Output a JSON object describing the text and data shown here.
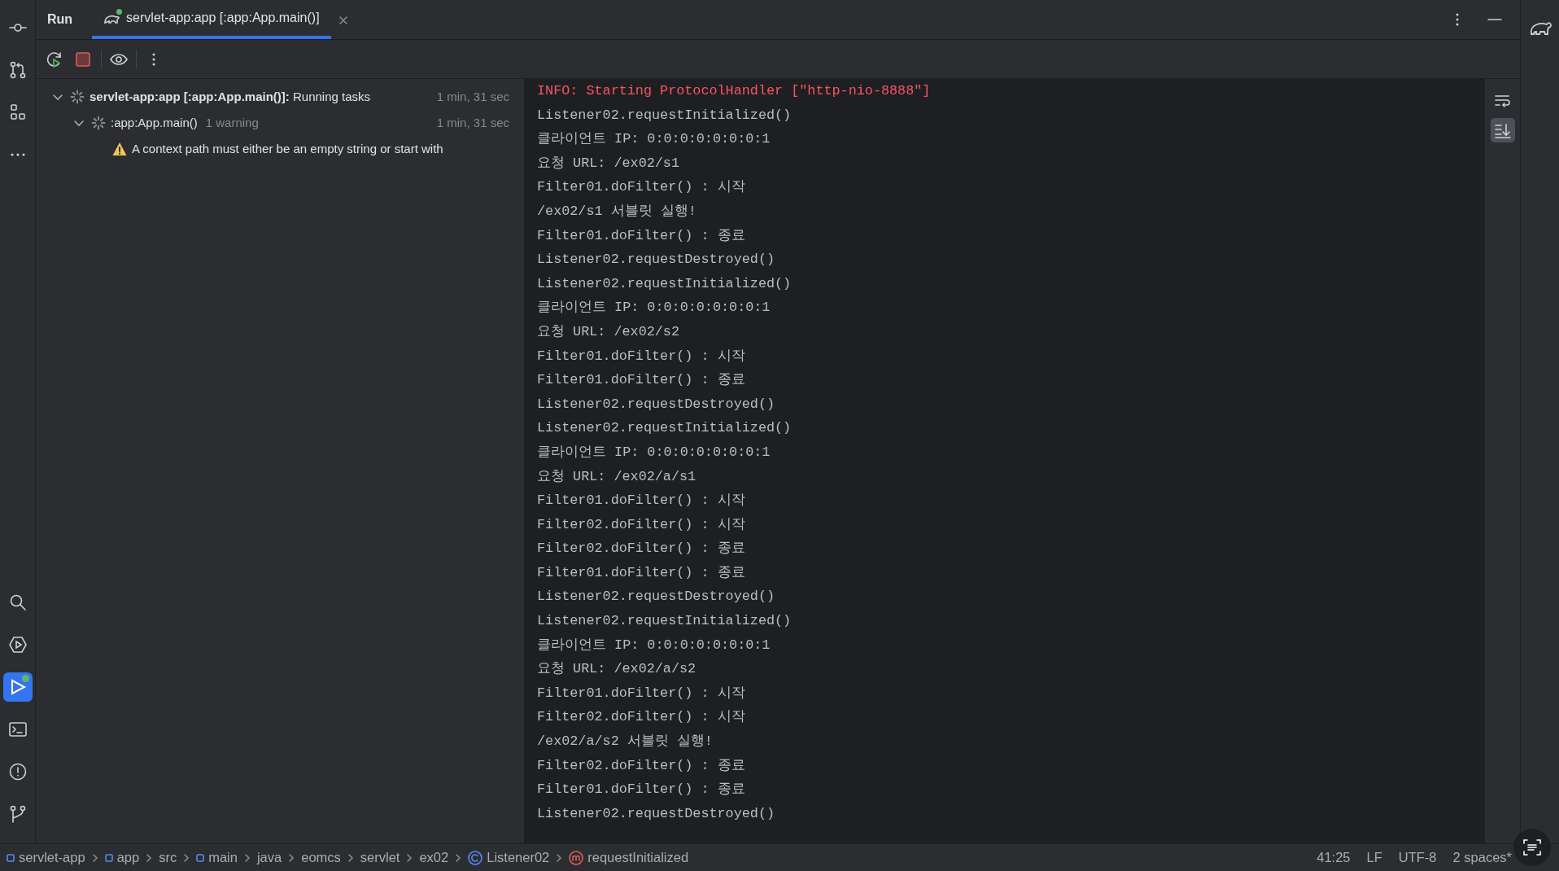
{
  "left_toolbar_top": [
    {
      "kind": "commit",
      "selected": false
    },
    {
      "kind": "pull-requests",
      "selected": false
    },
    {
      "kind": "structure",
      "selected": false
    },
    {
      "kind": "more",
      "selected": false
    }
  ],
  "left_toolbar_bottom": [
    {
      "kind": "search",
      "selected": false
    },
    {
      "kind": "services",
      "selected": false
    },
    {
      "kind": "run",
      "selected": true,
      "running": true
    },
    {
      "kind": "terminal",
      "selected": false
    },
    {
      "kind": "problems",
      "selected": false
    },
    {
      "kind": "git",
      "selected": false
    }
  ],
  "tool_window": {
    "title": "Run",
    "tabs": [
      {
        "label": "servlet-app:app [:app:App.main()]",
        "selected": true,
        "running": true
      }
    ]
  },
  "toolbar": [
    {
      "kind": "rerun"
    },
    {
      "kind": "stop"
    },
    {
      "kind": "separator"
    },
    {
      "kind": "view"
    },
    {
      "kind": "separator"
    },
    {
      "kind": "more"
    }
  ],
  "tree": [
    {
      "text": "**servlet-app:app [:app:App.main()]:** Running tasks",
      "time": "1 min, 31 sec",
      "expanded": true,
      "kind": "running",
      "children": [
        {
          "text": ":app:App.main()",
          "note": "1 warning",
          "time": "1 min, 31 sec",
          "expanded": true,
          "kind": "running",
          "children": [
            {
              "text": "A context path must either be an empty string or start with",
              "kind": "warning"
            }
          ]
        }
      ]
    }
  ],
  "console": [
    {
      "kind": "error",
      "text": "INFO: Starting ProtocolHandler [\"http-nio-8888\"]"
    },
    {
      "kind": "normal",
      "text": "Listener02.requestInitialized()"
    },
    {
      "kind": "normal",
      "text": "클라이언트 IP: 0:0:0:0:0:0:0:1"
    },
    {
      "kind": "normal",
      "text": "요청 URL: /ex02/s1"
    },
    {
      "kind": "normal",
      "text": "Filter01.doFilter() : 시작"
    },
    {
      "kind": "normal",
      "text": "/ex02/s1 서블릿 실행!"
    },
    {
      "kind": "normal",
      "text": "Filter01.doFilter() : 종료"
    },
    {
      "kind": "normal",
      "text": "Listener02.requestDestroyed()"
    },
    {
      "kind": "normal",
      "text": "Listener02.requestInitialized()"
    },
    {
      "kind": "normal",
      "text": "클라이언트 IP: 0:0:0:0:0:0:0:1"
    },
    {
      "kind": "normal",
      "text": "요청 URL: /ex02/s2"
    },
    {
      "kind": "normal",
      "text": "Filter01.doFilter() : 시작"
    },
    {
      "kind": "normal",
      "text": "Filter01.doFilter() : 종료"
    },
    {
      "kind": "normal",
      "text": "Listener02.requestDestroyed()"
    },
    {
      "kind": "normal",
      "text": "Listener02.requestInitialized()"
    },
    {
      "kind": "normal",
      "text": "클라이언트 IP: 0:0:0:0:0:0:0:1"
    },
    {
      "kind": "normal",
      "text": "요청 URL: /ex02/a/s1"
    },
    {
      "kind": "normal",
      "text": "Filter01.doFilter() : 시작"
    },
    {
      "kind": "normal",
      "text": "Filter02.doFilter() : 시작"
    },
    {
      "kind": "normal",
      "text": "Filter02.doFilter() : 종료"
    },
    {
      "kind": "normal",
      "text": "Filter01.doFilter() : 종료"
    },
    {
      "kind": "normal",
      "text": "Listener02.requestDestroyed()"
    },
    {
      "kind": "normal",
      "text": "Listener02.requestInitialized()"
    },
    {
      "kind": "normal",
      "text": "클라이언트 IP: 0:0:0:0:0:0:0:1"
    },
    {
      "kind": "normal",
      "text": "요청 URL: /ex02/a/s2"
    },
    {
      "kind": "normal",
      "text": "Filter01.doFilter() : 시작"
    },
    {
      "kind": "normal",
      "text": "Filter02.doFilter() : 시작"
    },
    {
      "kind": "normal",
      "text": "/ex02/a/s2 서블릿 실행!"
    },
    {
      "kind": "normal",
      "text": "Filter02.doFilter() : 종료"
    },
    {
      "kind": "normal",
      "text": "Filter01.doFilter() : 종료"
    },
    {
      "kind": "normal",
      "text": "Listener02.requestDestroyed()"
    }
  ],
  "console_gutter": [
    {
      "kind": "soft-wrap",
      "selected": false
    },
    {
      "kind": "scroll-to-end",
      "selected": true
    }
  ],
  "breadcrumbs": [
    {
      "label": "servlet-app",
      "kind": "module"
    },
    {
      "label": "app",
      "kind": "module"
    },
    {
      "label": "src",
      "kind": "folder"
    },
    {
      "label": "main",
      "kind": "module"
    },
    {
      "label": "java",
      "kind": "folder"
    },
    {
      "label": "eomcs",
      "kind": "folder"
    },
    {
      "label": "servlet",
      "kind": "folder"
    },
    {
      "label": "ex02",
      "kind": "folder"
    },
    {
      "label": "Listener02",
      "kind": "class"
    },
    {
      "label": "requestInitialized",
      "kind": "method"
    }
  ],
  "status_bar": {
    "position": "41:25",
    "line_separator": "LF",
    "encoding": "UTF-8",
    "indent": "2 spaces*"
  }
}
